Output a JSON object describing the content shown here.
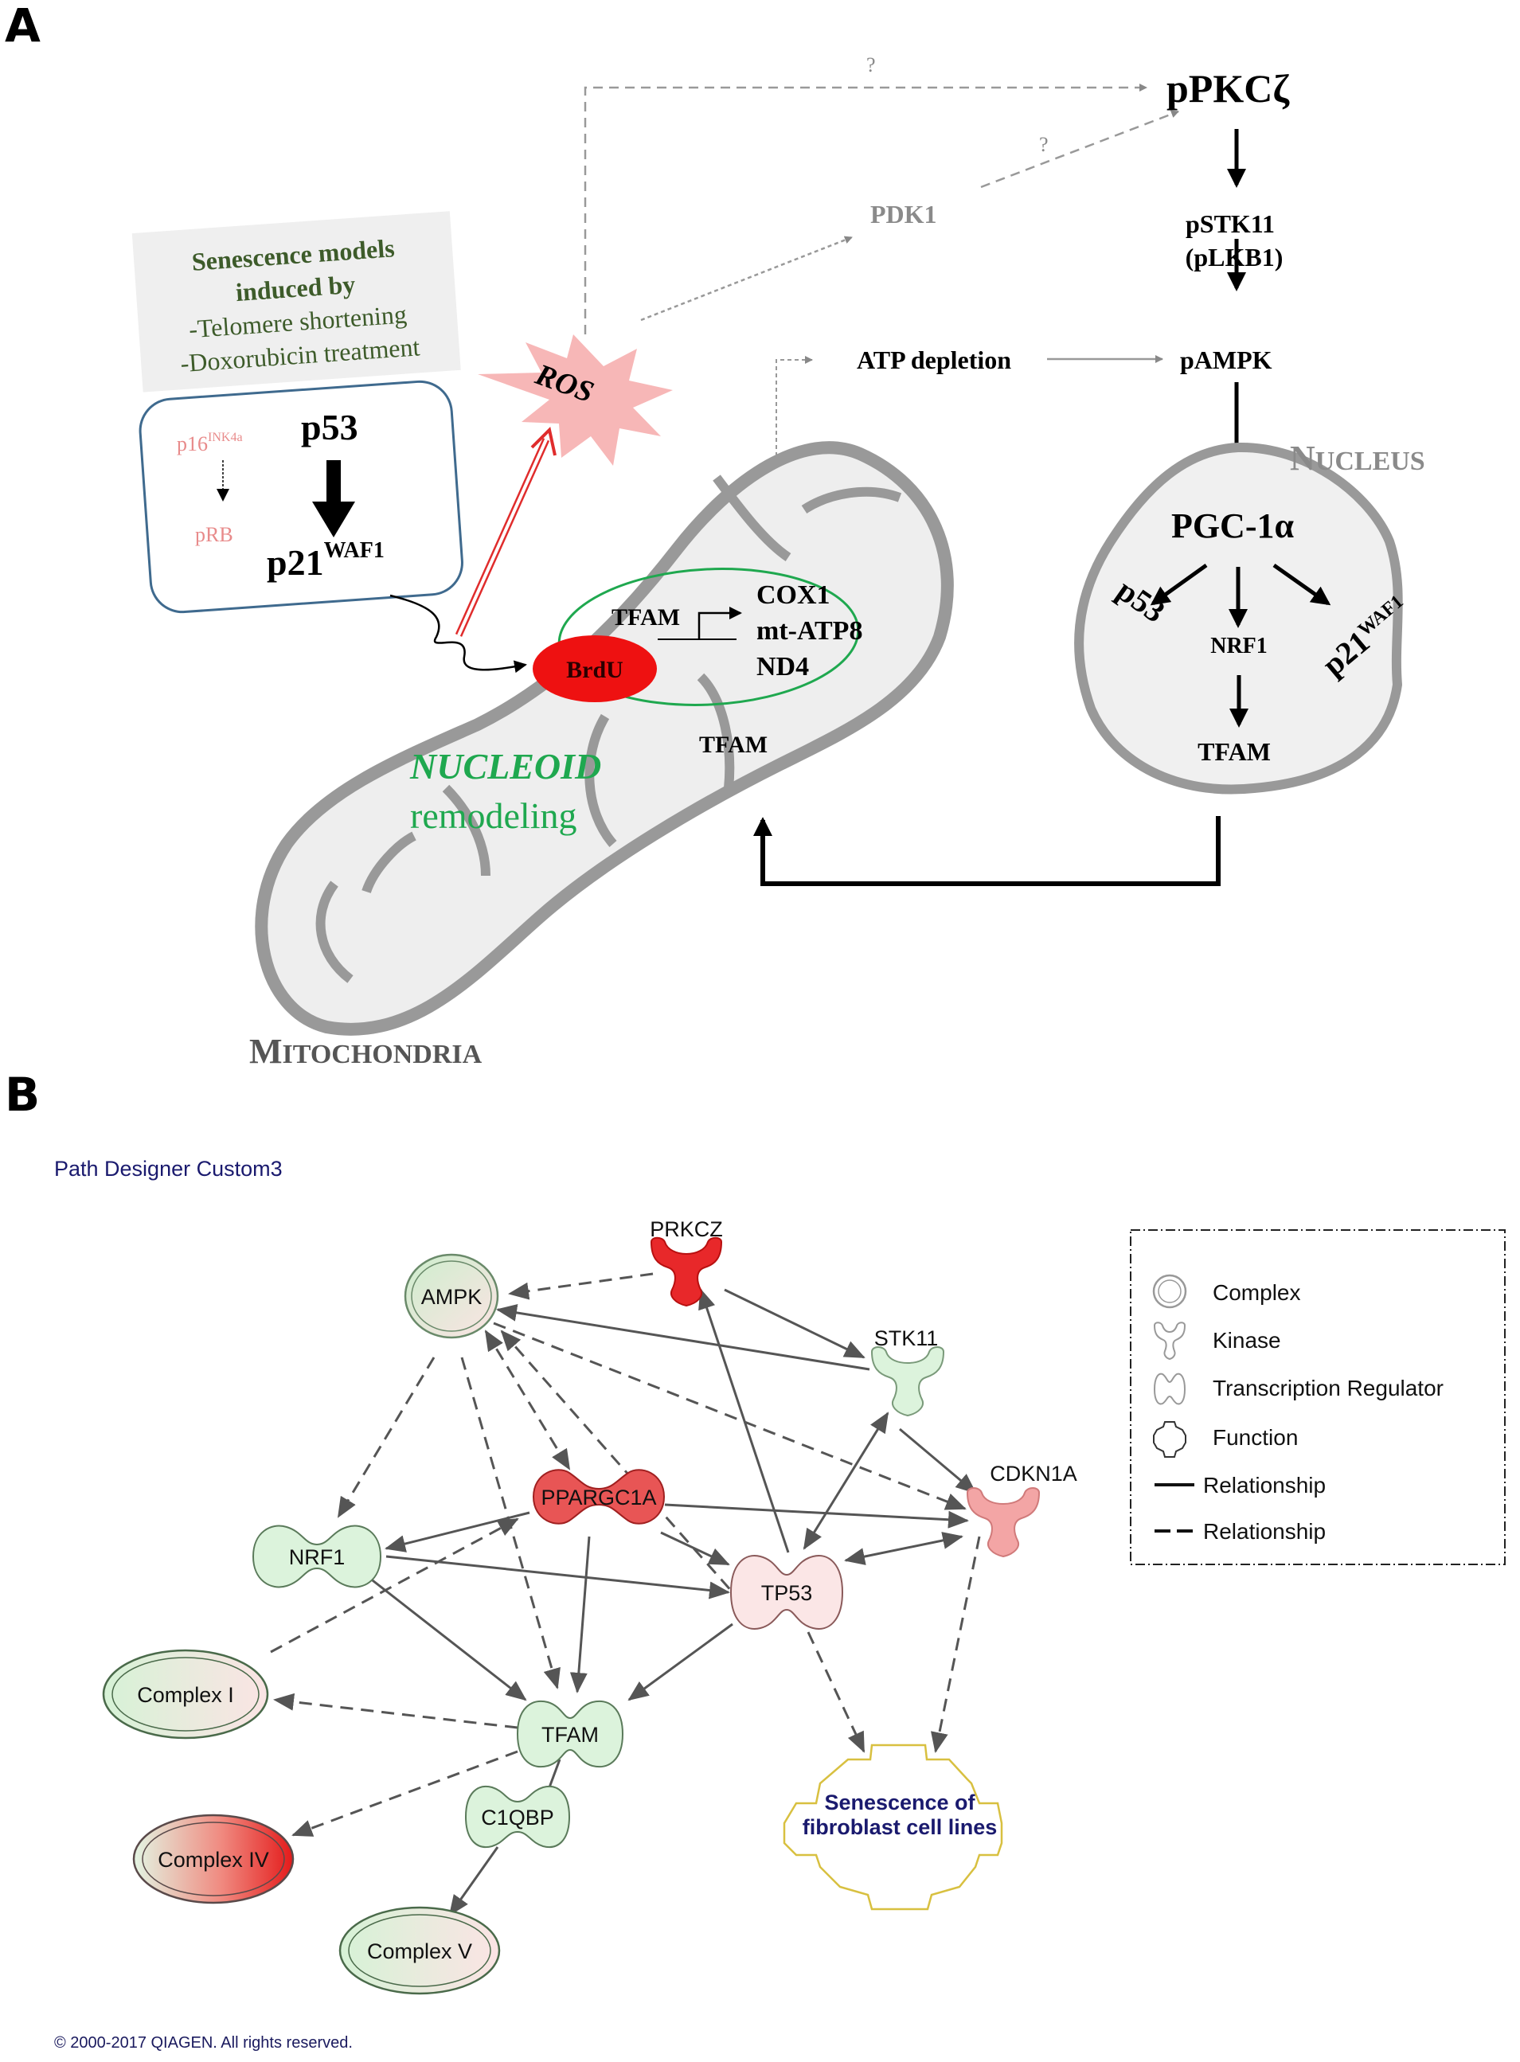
{
  "panel_a": {
    "letter": "A",
    "senescence_box": {
      "title_line1": "Senescence models",
      "title_line2": "induced by",
      "item1": "-Telomere shortening",
      "item2": "-Doxorubicin treatment"
    },
    "inner_box": {
      "p16": "p16",
      "p16_sup": "INK4a",
      "prb": "pRB",
      "p53": "p53",
      "p21": "p21",
      "p21_sup": "WAF1"
    },
    "ros": "ROS",
    "question_mark_top": "?",
    "question_mark_mid": "?",
    "pdk1": "PDK1",
    "ppkcz": "pPKCζ",
    "pstk11": "pSTK11",
    "plkb1": "(pLKB1)",
    "atp_depletion": "ATP depletion",
    "pampk": "pAMPK",
    "nucleus_label_initial": "N",
    "nucleus_label_rest": "UCLEUS",
    "nucleus": {
      "pgc1a": "PGC-1α",
      "p53": "p53",
      "nrf1": "NRF1",
      "p21": "p21",
      "p21_sup": "WAF1",
      "tfam": "TFAM"
    },
    "mito": {
      "brdu": "BrdU",
      "tfam_promoter": "TFAM",
      "cox1": "COX1",
      "mt_atp8": "mt-ATP8",
      "nd4": "ND4",
      "tfam_lower": "TFAM",
      "nucleoid": "NUCLEOID",
      "remodeling": "remodeling"
    },
    "mitochondria_label_initial": "M",
    "mitochondria_label_rest": "ITOCHONDRIA"
  },
  "panel_b": {
    "letter": "B",
    "title": "Path Designer Custom3",
    "nodes": {
      "prkcz": "PRKCZ",
      "ampk": "AMPK",
      "stk11": "STK11",
      "ppargc1a": "PPARGC1A",
      "cdkn1a": "CDKN1A",
      "nrf1": "NRF1",
      "tp53": "TP53",
      "complex_i": "Complex I",
      "tfam": "TFAM",
      "c1qbp": "C1QBP",
      "complex_iv": "Complex IV",
      "complex_v": "Complex V",
      "senescence_line1": "Senescence of",
      "senescence_line2": "fibroblast cell lines"
    },
    "legend": [
      {
        "shape": "complex",
        "label": "Complex"
      },
      {
        "shape": "kinase",
        "label": "Kinase"
      },
      {
        "shape": "transcription-regulator",
        "label": "Transcription Regulator"
      },
      {
        "shape": "function",
        "label": "Function"
      },
      {
        "shape": "solid-line",
        "label": "Relationship"
      },
      {
        "shape": "dashed-line",
        "label": "Relationship"
      }
    ],
    "copyright": "© 2000-2017 QIAGEN. All rights reserved.",
    "colors": {
      "red_strong": "#e8282a",
      "red_medium": "#e85555",
      "pink_light": "#f3a5a5",
      "pink_pale": "#fbe6e6",
      "green_pale": "#dcf3dc",
      "function_outline": "#d8c040"
    }
  }
}
